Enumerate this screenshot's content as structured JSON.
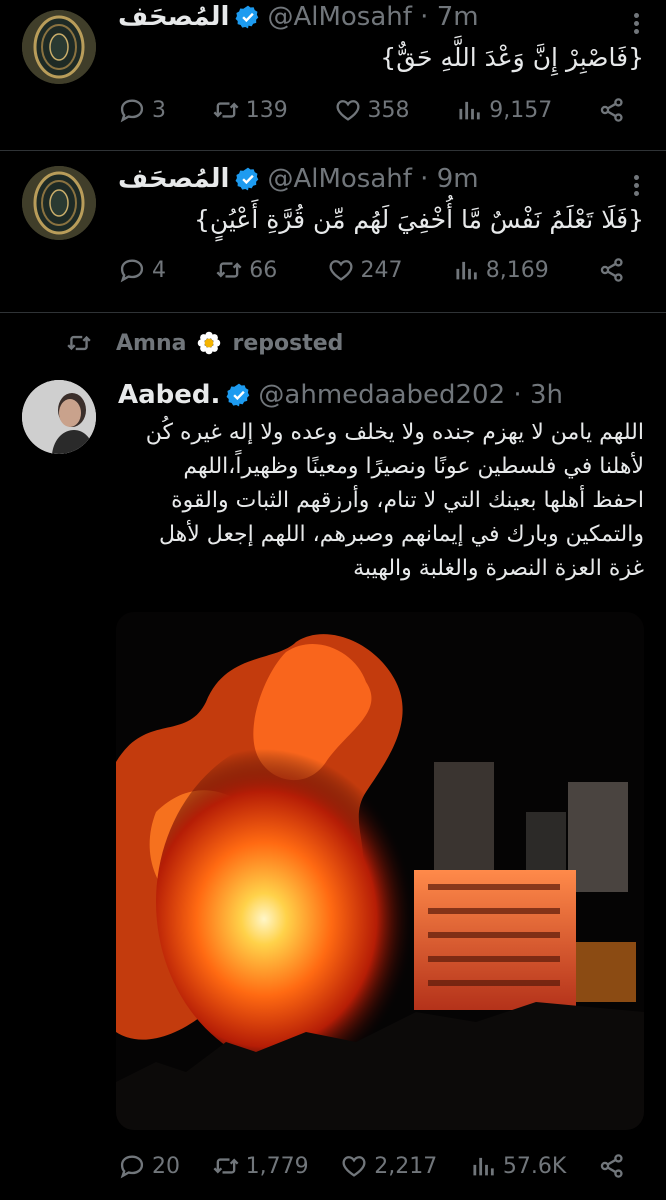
{
  "tweets": [
    {
      "name": "المُصحَف",
      "handle": "@AlMosahf",
      "time": "7m",
      "text": "{فَاصْبِرْ إِنَّ وَعْدَ اللَّهِ حَقٌّ}",
      "replies": "3",
      "reposts": "139",
      "likes": "358",
      "views": "9,157"
    },
    {
      "name": "المُصحَف",
      "handle": "@AlMosahf",
      "time": "9m",
      "text": "{فَلَا تَعْلَمُ نَفْسٌ مَّا أُخْفِيَ لَهُم مِّن قُرَّةِ أَعْيُنٍ}",
      "replies": "4",
      "reposts": "66",
      "likes": "247",
      "views": "8,169"
    },
    {
      "repost_by": "Amna",
      "repost_label": "reposted",
      "name": "Aabed.",
      "handle": "@ahmedaabed202",
      "time": "3h",
      "text_lines": [
        "اللهم يامن لا يهزم جنده ولا يخلف وعده ولا إله غيره كُن",
        "لأهلنا في فلسطين عونًا ونصيرًا ومعينًا وظهيراً،اللهم",
        "احفظ أهلها بعينك التي لا تنام، وأرزقهم الثبات والقوة",
        "والتمكين وبارك في إيمانهم وصبرهم، اللهم إجعل لأهل",
        "غزة العزة النصرة والغلبة والهيبة"
      ],
      "replies": "20",
      "reposts": "1,779",
      "likes": "2,217",
      "views": "57.6K"
    }
  ],
  "colors": {
    "verified": "#1d9bf0",
    "muted": "#71767b",
    "separator": "#2f3336"
  }
}
